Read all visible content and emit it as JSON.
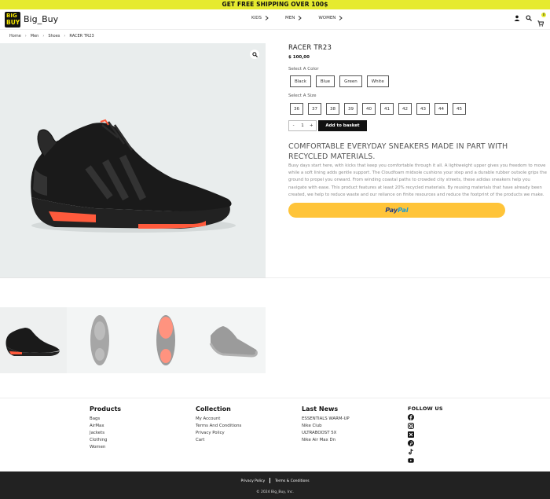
{
  "promo": {
    "text": "GET FREE SHIPPING OVER 100$"
  },
  "header": {
    "logo_line1": "BIG",
    "logo_line2": "BUY",
    "brand": "Big_Buy",
    "nav": [
      {
        "label": "KIDS"
      },
      {
        "label": "MEN"
      },
      {
        "label": "WOMEN"
      }
    ],
    "cart_count": "0",
    "icons": [
      "user-icon",
      "search-icon",
      "cart-icon"
    ]
  },
  "breadcrumb": [
    "Home",
    "Men",
    "Shoes",
    "RACER TR23"
  ],
  "product": {
    "title": "RACER TR23",
    "price": "$ 100,00",
    "color_label": "Select A Color",
    "colors": [
      "Black",
      "Blue",
      "Green",
      "White"
    ],
    "size_label": "Select A Size",
    "sizes": [
      "36",
      "37",
      "38",
      "39",
      "40",
      "41",
      "42",
      "43",
      "44",
      "45"
    ],
    "quantity": "1",
    "qty_minus": "-",
    "qty_plus": "+",
    "add_to_basket": "Add to basket",
    "desc_title": "COMFORTABLE EVERYDAY SNEAKERS MADE IN PART WITH RECYCLED MATERIALS.",
    "desc_body": "Busy days start here, with kicks that keep you comfortable through it all. A lightweight upper gives you freedom to move while a soft lining adds gentle support. The Cloudfoam midsole cushions your step and a durable rubber outsole grips the ground to propel you onward. From winding coastal paths to crowded city streets, these adidas sneakers help you navigate with ease. This product features at least 20% recycled materials. By reusing materials that have already been created, we help to reduce waste and our reliance on finite resources and reduce the footprint of the products we make.",
    "paypal_a": "Pay",
    "paypal_b": "Pal"
  },
  "colors": {
    "promo_bg": "#e6ea2f",
    "paypal_bg": "#ffc439",
    "gallery_bg": "#e9eded",
    "footer_dark": "#222222",
    "sole_accent": "#ff5a3c"
  },
  "footer": {
    "products": {
      "title": "Products",
      "links": [
        "Bags",
        "AirMax",
        "Jackets",
        "Clothing",
        "Women"
      ]
    },
    "collection": {
      "title": "Collection",
      "links": [
        "My Account",
        "Terms And Conditions",
        "Privacy Policy",
        "Cart"
      ]
    },
    "news": {
      "title": "Last News",
      "links": [
        "ESSENTIALS WARM-UP",
        "Nike Club",
        "ULTRABOOST 5X",
        "Nike Air Max Dn"
      ]
    },
    "follow": {
      "title": "FOLLOW US",
      "icons": [
        "facebook-icon",
        "instagram-icon",
        "x-icon",
        "pinterest-icon",
        "tiktok-icon",
        "youtube-icon"
      ]
    },
    "bottom_links": [
      "Privacy Policy",
      "Terms & Conditions"
    ],
    "copyright": "© 2024 Big_Buy, Inc."
  }
}
